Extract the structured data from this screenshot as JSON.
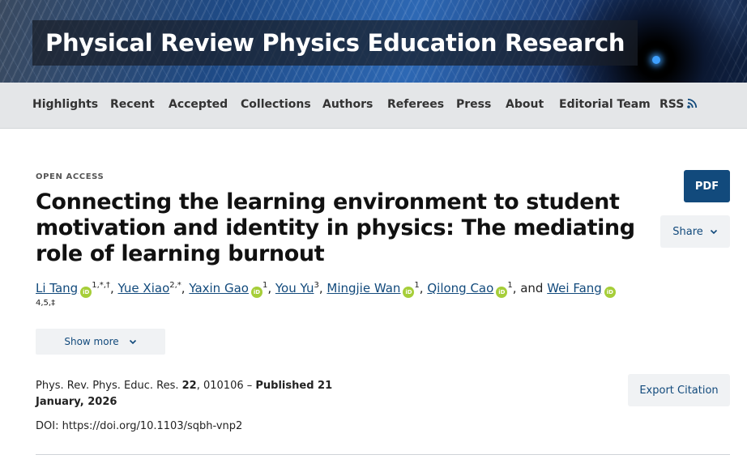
{
  "banner": {
    "title": "Physical Review Physics Education Research"
  },
  "nav": {
    "items": [
      {
        "label": "Highlights"
      },
      {
        "label": "Recent"
      },
      {
        "label": "Accepted"
      },
      {
        "label": "Collections"
      },
      {
        "label": "Authors"
      },
      {
        "label": "Referees"
      },
      {
        "label": "Press"
      },
      {
        "label": "About"
      },
      {
        "label": "Editorial Team"
      },
      {
        "label": "RSS",
        "icon": "rss-icon"
      }
    ]
  },
  "article": {
    "access_label": "OPEN ACCESS",
    "title": "Connecting the learning environment to student motivation and identity in physics: The mediating role of learning burnout",
    "authors": [
      {
        "name": "Li Tang",
        "orcid": true,
        "affil": "1,*,†",
        "sep": ", "
      },
      {
        "name": "Yue Xiao",
        "orcid": false,
        "affil": "2,*",
        "sep": ", "
      },
      {
        "name": "Yaxin Gao",
        "orcid": true,
        "affil": "1",
        "sep": ", "
      },
      {
        "name": "You Yu",
        "orcid": false,
        "affil": "3",
        "sep": ", "
      },
      {
        "name": "Mingjie Wan",
        "orcid": true,
        "affil": "1",
        "sep": ", "
      },
      {
        "name": "Qilong Cao",
        "orcid": true,
        "affil": "1",
        "sep": ", and "
      },
      {
        "name": "Wei Fang",
        "orcid": true,
        "affil": "4,5,‡",
        "sep": ""
      }
    ],
    "orcid_glyph": "iD",
    "show_more_label": "Show more",
    "citation": {
      "journal": "Phys. Rev. Phys. Educ. Res.",
      "volume": "22",
      "article_number": ", 010106 –",
      "published": "Published 21 January, 2026"
    },
    "doi": "DOI: https://doi.org/10.1103/sqbh-vnp2"
  },
  "actions": {
    "pdf_label": "PDF",
    "share_label": "Share",
    "export_label": "Export Citation"
  },
  "colors": {
    "link": "#124a7c",
    "pdf_button": "#124a7c",
    "orcid": "#a6ce39",
    "nav_bg": "#e4e6e8"
  }
}
